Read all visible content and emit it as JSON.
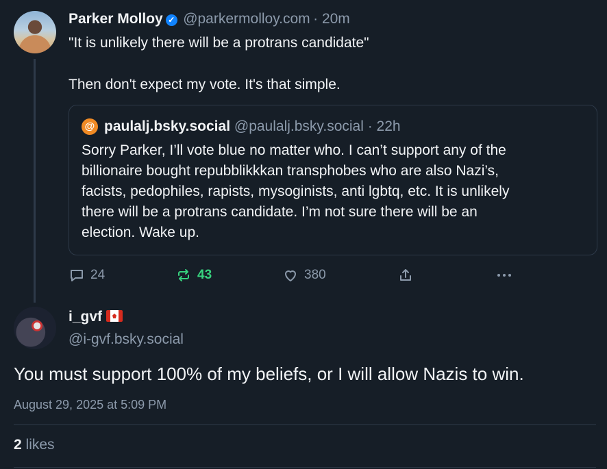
{
  "post": {
    "author_name": "Parker Molloy",
    "author_handle": "@parkermolloy.com",
    "time": "· 20m",
    "line1": "\"It is unlikely there will be a protrans candidate\"",
    "line2": "Then don't expect my vote. It's that simple.",
    "quote": {
      "author_name": "paulalj.bsky.social",
      "author_handle": "@paulalj.bsky.social",
      "time": "· 22h",
      "avatar_glyph": "@",
      "lines": [
        "Sorry Parker, I’ll vote blue no matter who. I can’t support any of the",
        "billionaire bought repubblikkkan  transphobes who are also Nazi’s,",
        "facists, pedophiles, rapists, mysoginists, anti lgbtq, etc. It is unlikely",
        "there will be a protrans candidate. I’m not sure there will be an",
        "election. Wake up."
      ]
    },
    "actions": {
      "replies": "24",
      "reposts": "43",
      "likes": "380"
    }
  },
  "reply": {
    "author_name": "i_gvf",
    "author_handle": "@i-gvf.bsky.social",
    "text": "You must support 100% of my beliefs, or I will allow Nazis to win.",
    "timestamp": "August 29, 2025 at 5:09 PM",
    "like_count": "2",
    "like_label": "likes"
  },
  "colors": {
    "background": "#161e27",
    "muted": "#8c9aab",
    "repost_active": "#37d27e",
    "verified": "#1083fe"
  }
}
